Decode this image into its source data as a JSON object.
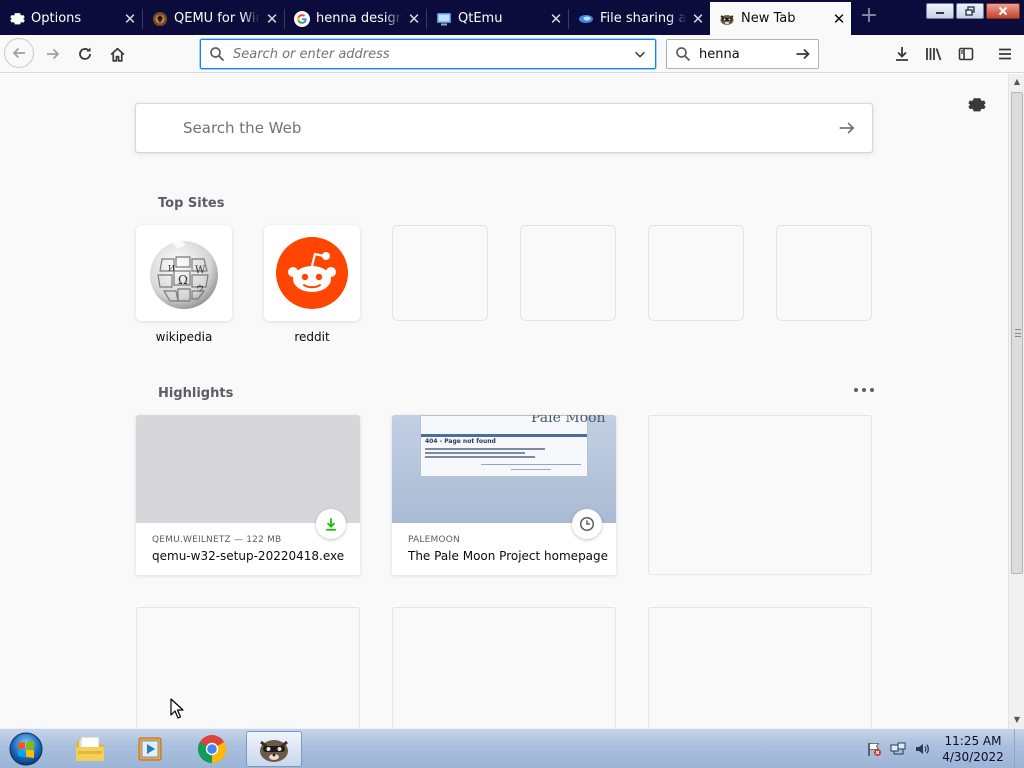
{
  "browser": {
    "tabs": [
      {
        "title": "Options",
        "icon": "gear-icon",
        "active": false
      },
      {
        "title": "QEMU for Windows",
        "icon": "qemu-icon",
        "active": false
      },
      {
        "title": "henna designs",
        "icon": "google-icon",
        "active": false
      },
      {
        "title": "QtEmu",
        "icon": "qtemu-icon",
        "active": false
      },
      {
        "title": "File sharing and",
        "icon": "file-sharing-icon",
        "active": false
      },
      {
        "title": "New Tab",
        "icon": "palemoon-icon",
        "active": true
      }
    ],
    "new_tab_symbol": "+",
    "close_symbol": "✕",
    "address_bar": {
      "value": "",
      "placeholder": "Search or enter address"
    },
    "search_bar": {
      "value": "henna"
    }
  },
  "new_tab_page": {
    "web_search_placeholder": "Search the Web",
    "top_sites": {
      "title": "Top Sites",
      "sites": [
        {
          "label": "wikipedia",
          "icon": "wikipedia-icon"
        },
        {
          "label": "reddit",
          "icon": "reddit-icon"
        },
        {
          "label": "",
          "icon": ""
        },
        {
          "label": "",
          "icon": ""
        },
        {
          "label": "",
          "icon": ""
        },
        {
          "label": "",
          "icon": ""
        }
      ]
    },
    "highlights": {
      "title": "Highlights",
      "cards": [
        {
          "host": "QEMU.WEILNETZ — 122 MB",
          "title": "qemu-w32-setup-20220418.exe",
          "badge": "download-icon"
        },
        {
          "host": "PALEMOON",
          "title": "The Pale Moon Project homepage",
          "badge": "clock-icon",
          "preview_heading": "Pale Moon",
          "preview_error": "404 - Page not found"
        },
        {
          "host": "",
          "title": ""
        },
        {
          "host": "",
          "title": ""
        },
        {
          "host": "",
          "title": ""
        },
        {
          "host": "",
          "title": ""
        }
      ]
    }
  },
  "taskbar": {
    "apps": [
      {
        "name": "file-explorer",
        "icon": "folder-icon",
        "active": false
      },
      {
        "name": "media-player",
        "icon": "media-player-icon",
        "active": false
      },
      {
        "name": "chrome",
        "icon": "chrome-icon",
        "active": false
      },
      {
        "name": "palemoon",
        "icon": "palemoon-icon",
        "active": true
      }
    ],
    "clock": {
      "time": "11:25 AM",
      "date": "4/30/2022"
    }
  },
  "colors": {
    "tabstrip": "#0c0c3c",
    "accent": "#0a84ff",
    "download_green": "#12bc00",
    "reddit_orange": "#ff4500"
  }
}
